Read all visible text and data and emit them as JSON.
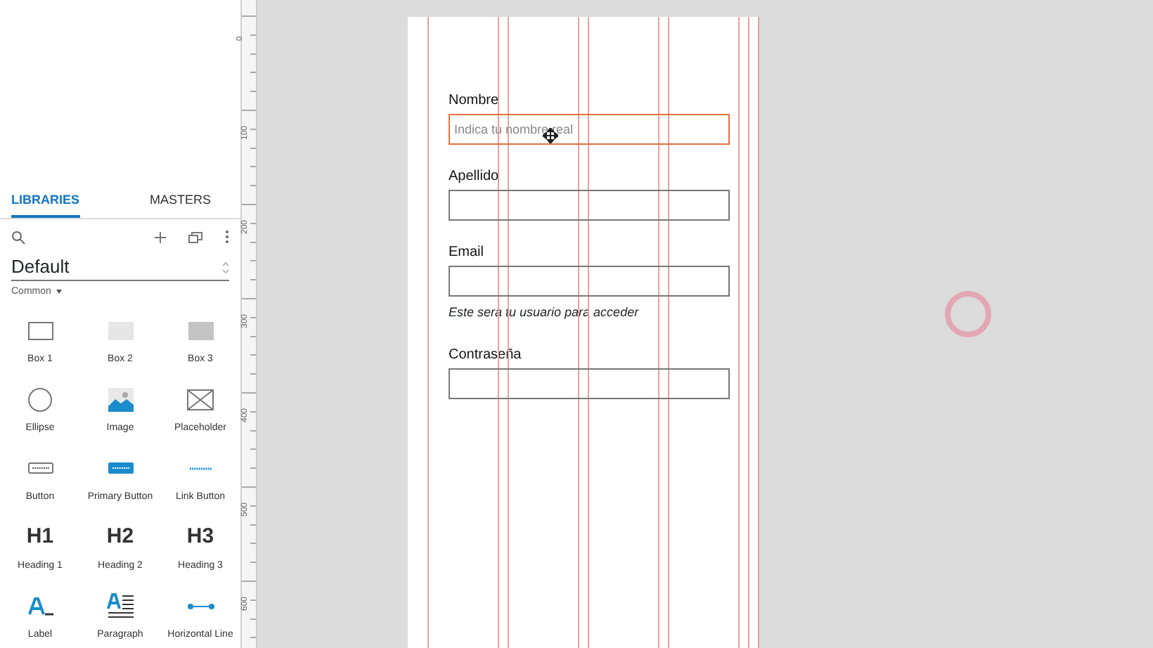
{
  "sidebar": {
    "tabs": [
      {
        "label": "LIBRARIES",
        "selected": true
      },
      {
        "label": "MASTERS",
        "selected": false
      }
    ],
    "library_name": "Default",
    "section": "Common",
    "widgets": [
      {
        "label": "Box 1",
        "kind": "box1"
      },
      {
        "label": "Box 2",
        "kind": "box2"
      },
      {
        "label": "Box 3",
        "kind": "box3"
      },
      {
        "label": "Ellipse",
        "kind": "ellipse"
      },
      {
        "label": "Image",
        "kind": "image"
      },
      {
        "label": "Placeholder",
        "kind": "placeholder"
      },
      {
        "label": "Button",
        "kind": "button"
      },
      {
        "label": "Primary Button",
        "kind": "primary"
      },
      {
        "label": "Link Button",
        "kind": "link"
      },
      {
        "label": "Heading 1",
        "kind": "heading",
        "glyph": "H1"
      },
      {
        "label": "Heading 2",
        "kind": "heading",
        "glyph": "H2"
      },
      {
        "label": "Heading 3",
        "kind": "heading",
        "glyph": "H3"
      },
      {
        "label": "Label",
        "kind": "label"
      },
      {
        "label": "Paragraph",
        "kind": "paragraph"
      },
      {
        "label": "Horizontal Line",
        "kind": "hline"
      }
    ]
  },
  "ruler": [
    "0",
    "100",
    "200",
    "300",
    "400",
    "500",
    "600"
  ],
  "form": {
    "fields": [
      {
        "label": "Nombre",
        "placeholder": "Indica tu nombre real",
        "selected": true
      },
      {
        "label": "Apellido",
        "selected": false
      },
      {
        "label": "Email",
        "selected": false,
        "helper": "Este sera tu usuario para acceder"
      },
      {
        "label": "Contraseña",
        "selected": false
      }
    ]
  }
}
